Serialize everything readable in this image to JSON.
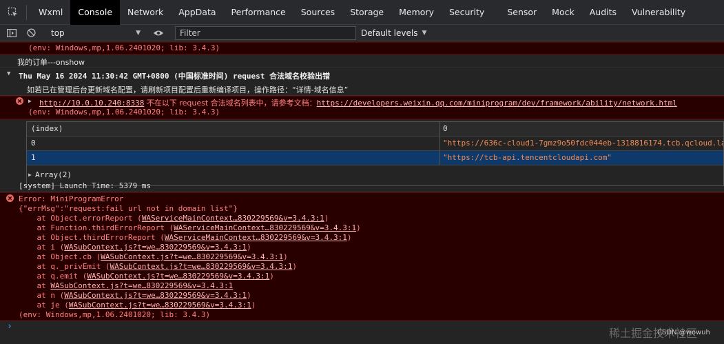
{
  "tabs": [
    "Wxml",
    "Console",
    "Network",
    "AppData",
    "Performance",
    "Sources",
    "Storage",
    "Memory",
    "Security",
    "Sensor",
    "Mock",
    "Audits",
    "Vulnerability"
  ],
  "toolbar": {
    "context": "top",
    "filter_placeholder": "Filter",
    "levels": "Default levels"
  },
  "console": {
    "env_line_top": "(env: Windows,mp,1.06.2401020; lib: 3.4.3)",
    "onshow": "我的订单---onshow",
    "group_header": "Thu May 16 2024 11:30:42 GMT+0800 (中国标准时间) request 合法域名校验出错",
    "group_info": "如若已在管理后台更新域名配置，请刷新项目配置后重新编译项目，操作路径：“详情-域名信息”",
    "domain_error": {
      "url": "http://10.0.10.240:8338",
      "middle": " 不在以下 request 合法域名列表中，请参考文档：",
      "doc": "https://developers.weixin.qq.com/miniprogram/dev/framework/ability/network.html",
      "env": "(env: Windows,mp,1.06.2401020; lib: 3.4.3)"
    },
    "table": {
      "headers": [
        "(index)",
        "0"
      ],
      "rows": [
        {
          "index": "0",
          "value": "\"https://636c-cloud1-7gmz9o50fdc044eb-1318816174.tcb.qcloud.la"
        },
        {
          "index": "1",
          "value": "\"https://tcb-api.tencentcloudapi.com\""
        }
      ],
      "footer": "Array(2)"
    },
    "launch": "[system] Launch Time: 5379 ms",
    "error": {
      "title": "Error: MiniProgramError",
      "msg": "{\"errMsg\":\"request:fail url not in domain list\"}",
      "stack": [
        {
          "pre": "    at Object.errorReport (",
          "link": "WAServiceMainContext…830229569&v=3.4.3:1",
          "post": ")"
        },
        {
          "pre": "    at Function.thirdErrorReport (",
          "link": "WAServiceMainContext…830229569&v=3.4.3:1",
          "post": ")"
        },
        {
          "pre": "    at Object.thirdErrorReport (",
          "link": "WAServiceMainContext…830229569&v=3.4.3:1",
          "post": ")"
        },
        {
          "pre": "    at i (",
          "link": "WASubContext.js?t=we…830229569&v=3.4.3:1",
          "post": ")"
        },
        {
          "pre": "    at Object.cb (",
          "link": "WASubContext.js?t=we…830229569&v=3.4.3:1",
          "post": ")"
        },
        {
          "pre": "    at q._privEmit (",
          "link": "WASubContext.js?t=we…830229569&v=3.4.3:1",
          "post": ")"
        },
        {
          "pre": "    at q.emit (",
          "link": "WASubContext.js?t=we…830229569&v=3.4.3:1",
          "post": ")"
        },
        {
          "pre": "    at ",
          "link": "WASubContext.js?t=we…830229569&v=3.4.3:1",
          "post": ""
        },
        {
          "pre": "    at n (",
          "link": "WASubContext.js?t=we…830229569&v=3.4.3:1",
          "post": ")"
        },
        {
          "pre": "    at je (",
          "link": "WASubContext.js?t=we…830229569&v=3.4.3:1",
          "post": ")"
        }
      ],
      "env": "(env: Windows,mp,1.06.2401020; lib: 3.4.3)"
    },
    "prompt": "›"
  },
  "watermark": {
    "main": "稀土掘金技术社区",
    "credit": "CSDN @wowuh"
  },
  "colors": {
    "error_bg": "#290000",
    "error_text": "#ff8080",
    "string": "#f28b54",
    "selected_row": "#0e3a6b"
  }
}
